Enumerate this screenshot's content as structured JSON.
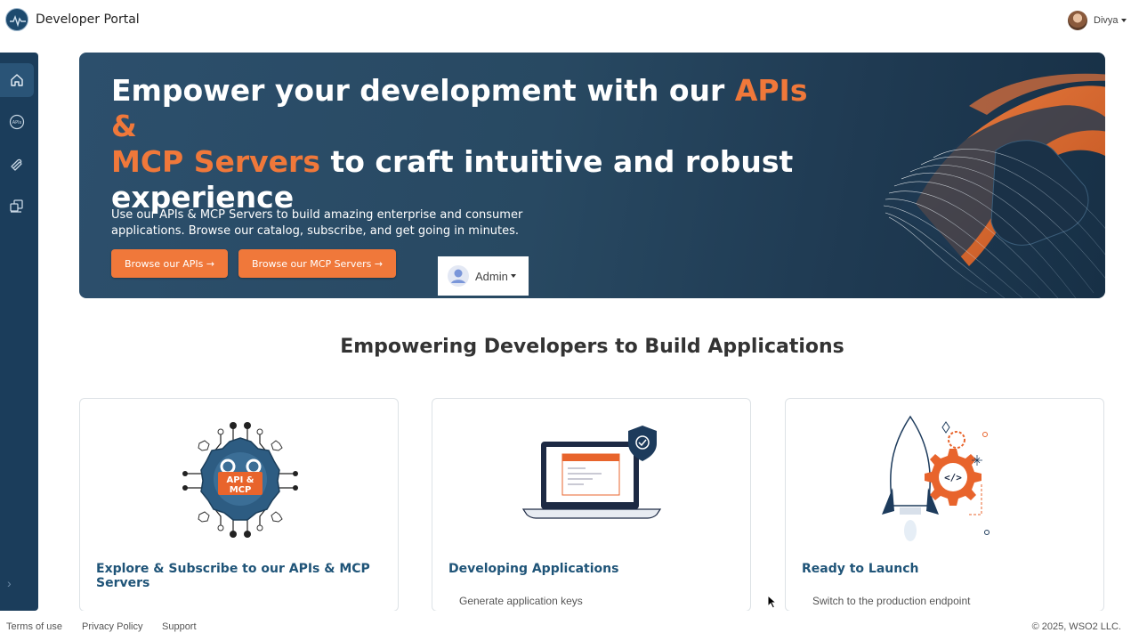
{
  "header": {
    "app_title": "Developer Portal",
    "user_name": "Divya"
  },
  "sidebar": {
    "items": [
      {
        "icon": "home-icon"
      },
      {
        "icon": "apis-icon",
        "glyph": "APIs"
      },
      {
        "icon": "mcp-servers-icon"
      },
      {
        "icon": "applications-icon"
      }
    ]
  },
  "hero": {
    "title_accent_1": "APIs &",
    "title_part_1": "Empower your development with our ",
    "title_accent_2": "MCP Servers",
    "title_part_2": " to craft intuitive and robust experience",
    "subtitle": "Use our APIs & MCP Servers to build amazing enterprise and consumer applications. Browse our catalog, subscribe, and get going in minutes.",
    "browse_apis_label": "Browse our APIs →",
    "browse_mcp_label": "Browse our MCP Servers →",
    "accent_color": "#f0783a"
  },
  "admin_menu": {
    "label": "Admin"
  },
  "section": {
    "title": "Empowering Developers to Build Applications"
  },
  "cards": [
    {
      "title": "Explore & Subscribe to our APIs & MCP Servers",
      "art_label_1": "API &",
      "art_label_2": "MCP",
      "line": ""
    },
    {
      "title": "Developing Applications",
      "line": "Generate application keys"
    },
    {
      "title": "Ready to Launch",
      "line": "Switch to the production endpoint"
    }
  ],
  "footer": {
    "terms": "Terms of use",
    "privacy": "Privacy Policy",
    "support": "Support",
    "copyright": "© 2025, WSO2 LLC."
  }
}
